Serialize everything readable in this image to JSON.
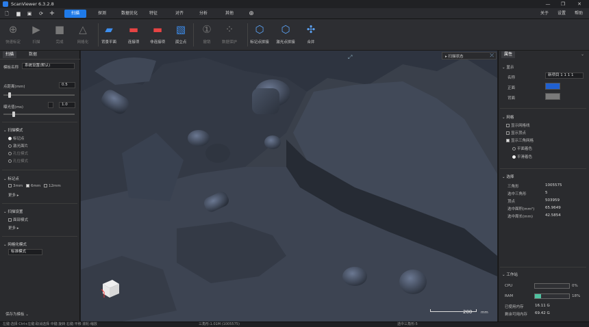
{
  "app": {
    "title": "ScanViewer 6.3.2.8"
  },
  "menu": {
    "tabs": [
      "扫描",
      "探测",
      "数据优化",
      "特征",
      "对齐",
      "分析",
      "其他"
    ],
    "active": 0,
    "right": [
      "关于",
      "设置",
      "帮助"
    ]
  },
  "toolbar": {
    "groups": [
      {
        "items": [
          {
            "label": "快速标定",
            "icon": "crosshair-icon",
            "enabled": false
          },
          {
            "label": "扫描",
            "icon": "play-icon",
            "enabled": false
          },
          {
            "label": "完成",
            "icon": "stop-icon",
            "enabled": false
          },
          {
            "label": "网格化",
            "icon": "triangle-mesh-icon",
            "enabled": false
          }
        ]
      },
      {
        "items": [
          {
            "label": "背景平面",
            "icon": "plane-icon",
            "enabled": true
          },
          {
            "label": "连接项",
            "icon": "connect-icon",
            "enabled": true
          },
          {
            "label": "非连接项",
            "icon": "disconnect-icon",
            "enabled": true
          },
          {
            "label": "孤立点",
            "icon": "isolated-point-icon",
            "enabled": true
          }
        ]
      },
      {
        "items": [
          {
            "label": "撤销",
            "icon": "undo-icon",
            "enabled": false
          },
          {
            "label": "数据保护",
            "icon": "data-protect-icon",
            "enabled": false
          }
        ]
      },
      {
        "items": [
          {
            "label": "标记点拼接",
            "icon": "marker-stitch-icon",
            "enabled": true
          },
          {
            "label": "激光点拼接",
            "icon": "laser-stitch-icon",
            "enabled": true
          },
          {
            "label": "合并",
            "icon": "merge-icon",
            "enabled": true
          }
        ]
      }
    ]
  },
  "left": {
    "tabs": [
      "扫描",
      "数据"
    ],
    "template_label": "模板名称",
    "template_value": "系统设置(默认)",
    "point_spacing_label": "点距离(mm)",
    "point_spacing_value": "0.5",
    "exposure_label": "曝光值(ms)",
    "exposure_value": "1.0",
    "scan_mode": {
      "title": "扫描模式",
      "options": [
        "标记点",
        "激光面片",
        "孔位模式",
        "孔位模式"
      ],
      "selected": 0
    },
    "marker": {
      "title": "标记点",
      "options": [
        "3mm",
        "6mm",
        "12mm"
      ],
      "checked": [
        false,
        true,
        false
      ],
      "more": "更多"
    },
    "scan_settings": {
      "title": "扫描设置",
      "option": "面部模式",
      "more": "更多"
    },
    "mesh": {
      "title": "网格化模式",
      "value": "标准模式"
    },
    "save_template": "保存为模板"
  },
  "viewport": {
    "scan_status_label": "扫描状态",
    "scale_value": "200",
    "scale_unit": "mm"
  },
  "right": {
    "title": "属性",
    "display": {
      "title": "显示",
      "name_label": "名称",
      "name_value": "新项目 1 1 1 1",
      "front_label": "正面",
      "back_label": "背面",
      "front_color": "#2060d0",
      "back_color": "#7a7a7a"
    },
    "mesh": {
      "title": "网格",
      "options": [
        "显示网格线",
        "显示顶点",
        "显示三角网格"
      ],
      "checked": [
        false,
        false,
        true
      ],
      "shade": [
        "平面着色",
        "平滑着色"
      ],
      "shade_selected": 1
    },
    "selection": {
      "title": "选择",
      "rows": [
        {
          "k": "三角形",
          "v": "1005575"
        },
        {
          "k": "选中三角形",
          "v": "5"
        },
        {
          "k": "顶点",
          "v": "503959"
        },
        {
          "k": "选中面积(mm²)",
          "v": "65.9649"
        },
        {
          "k": "选中周长(mm)",
          "v": "42.5854"
        }
      ]
    },
    "workstation": {
      "title": "工作站",
      "cpu_label": "CPU",
      "cpu_pct": "0%",
      "cpu_val": 0,
      "ram_label": "RAM",
      "ram_pct": "18%",
      "ram_val": 0.18,
      "used_label": "已使用内存",
      "used_value": "16.11 G",
      "free_label": "剩余可用内存",
      "free_value": "69.42 G"
    }
  },
  "status": {
    "hint": "左键:选择 Ctrl+左键:取消选择 中键:旋转 右键:平移 滚轮:缩放",
    "tri": "三角形:1.01M (1005575)",
    "sel": "选中三角形:5"
  },
  "colors": {
    "accent": "#1f7ae8",
    "ram": "#4fc3a1"
  }
}
